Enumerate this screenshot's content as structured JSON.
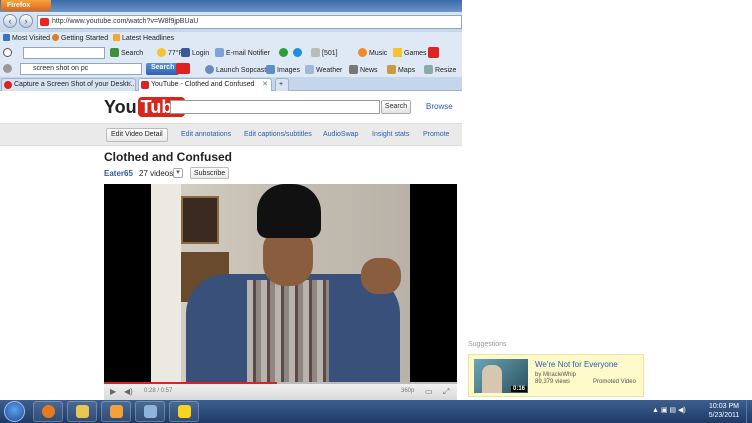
{
  "browser": {
    "app_button": "Firefox",
    "url": "http://www.youtube.com/watch?v=W8f9jpBUaU",
    "bookmarks": [
      {
        "label": "Most Visited",
        "color": "#3a72c4"
      },
      {
        "label": "Getting Started",
        "color": "#e27b1d"
      },
      {
        "label": "Latest Headlines",
        "color": "#f2a82a"
      }
    ],
    "toolbar1": {
      "search_label": "Search",
      "weather": "77°F",
      "login": "Login",
      "email_notifier": "E-mail Notifier",
      "count": "[501]",
      "music": "Music",
      "games": "Games"
    },
    "toolbar2": {
      "search_query": "screen shot on pc",
      "search_button": "Search",
      "launch_sopcast": "Launch Sopcast",
      "images": "Images",
      "weather": "Weather",
      "news": "News",
      "maps": "Maps",
      "resize": "Resize"
    },
    "tabs": [
      {
        "title": "Capture a Screen Shot of your Deskt...",
        "active": false
      },
      {
        "title": "YouTube - Clothed and Confused",
        "active": true
      }
    ],
    "new_tab": "+"
  },
  "youtube": {
    "logo_you": "You",
    "logo_tube": "Tube",
    "search_button": "Search",
    "browse": "Browse",
    "owner_bar": {
      "edit_video": "Edit Video Detail",
      "links": [
        "Edit annotations",
        "Edit captions/subtitles",
        "AudioSwap",
        "Insight stats",
        "Promote"
      ]
    },
    "video_title": "Clothed and Confused",
    "channel": "Eater65",
    "video_count": "27 videos",
    "subscribe": "Subscribe",
    "player": {
      "timecode": "0:28 / 0:57",
      "quality": "360p",
      "progress": 0.49
    }
  },
  "suggestions": {
    "label": "Suggestions",
    "item": {
      "title": "We're Not for Everyone",
      "by": "by MiracleWhip",
      "views": "89,379 views",
      "promoted": "Promoted Video",
      "duration": "0:16"
    }
  },
  "taskbar": {
    "time": "10:03 PM",
    "date": "5/23/2011",
    "apps": [
      {
        "name": "firefox",
        "color": "#e67a1e"
      },
      {
        "name": "explorer",
        "color": "#e7c653"
      },
      {
        "name": "media-player",
        "color": "#f0a33a"
      },
      {
        "name": "network",
        "color": "#8fb3d9"
      },
      {
        "name": "aim",
        "color": "#f7d41d"
      }
    ]
  }
}
